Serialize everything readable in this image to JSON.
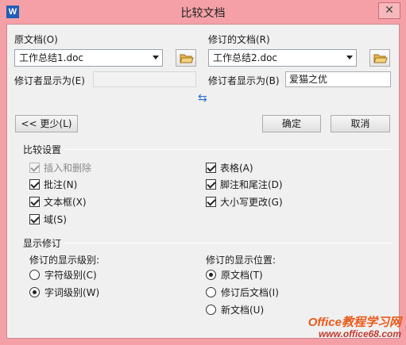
{
  "window": {
    "title": "比较文档",
    "app_icon_letter": "W",
    "close_glyph": "✕"
  },
  "original": {
    "label": "原文档(O)",
    "file": "工作总结1.doc",
    "reviewer_label": "修订者显示为(E)",
    "reviewer_value": ""
  },
  "revised": {
    "label": "修订的文档(R)",
    "file": "工作总结2.doc",
    "reviewer_label": "修订者显示为(B)",
    "reviewer_value": "爱猫之优"
  },
  "swap_icon": "⇆",
  "buttons": {
    "less": "<< 更少(L)",
    "ok": "确定",
    "cancel": "取消"
  },
  "compare_settings": {
    "title": "比较设置",
    "options": [
      {
        "label": "插入和删除",
        "checked": true,
        "disabled": true
      },
      {
        "label": "批注(N)",
        "checked": true
      },
      {
        "label": "文本框(X)",
        "checked": true
      },
      {
        "label": "域(S)",
        "checked": true
      },
      {
        "label": "表格(A)",
        "checked": true
      },
      {
        "label": "脚注和尾注(D)",
        "checked": true
      },
      {
        "label": "大小写更改(G)",
        "checked": true
      }
    ]
  },
  "show_changes": {
    "title": "显示修订",
    "level_label": "修订的显示级别:",
    "level_options": [
      {
        "label": "字符级别(C)",
        "checked": false
      },
      {
        "label": "字词级别(W)",
        "checked": true
      }
    ],
    "position_label": "修订的显示位置:",
    "position_options": [
      {
        "label": "原文档(T)",
        "checked": true
      },
      {
        "label": "修订后文档(I)",
        "checked": false
      },
      {
        "label": "新文档(U)",
        "checked": false
      }
    ]
  },
  "watermark": {
    "line1": "Office教程学习网",
    "line2": "www.office68.com"
  }
}
